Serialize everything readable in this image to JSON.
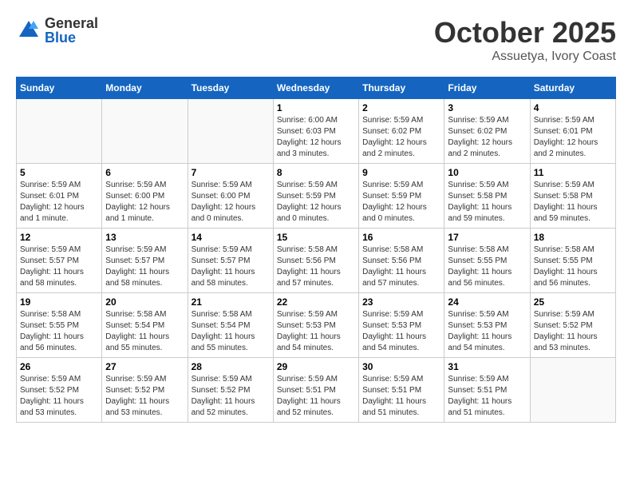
{
  "logo": {
    "general": "General",
    "blue": "Blue"
  },
  "title": {
    "month": "October 2025",
    "location": "Assuetya, Ivory Coast"
  },
  "headers": [
    "Sunday",
    "Monday",
    "Tuesday",
    "Wednesday",
    "Thursday",
    "Friday",
    "Saturday"
  ],
  "weeks": [
    [
      {
        "day": "",
        "info": ""
      },
      {
        "day": "",
        "info": ""
      },
      {
        "day": "",
        "info": ""
      },
      {
        "day": "1",
        "info": "Sunrise: 6:00 AM\nSunset: 6:03 PM\nDaylight: 12 hours\nand 3 minutes."
      },
      {
        "day": "2",
        "info": "Sunrise: 5:59 AM\nSunset: 6:02 PM\nDaylight: 12 hours\nand 2 minutes."
      },
      {
        "day": "3",
        "info": "Sunrise: 5:59 AM\nSunset: 6:02 PM\nDaylight: 12 hours\nand 2 minutes."
      },
      {
        "day": "4",
        "info": "Sunrise: 5:59 AM\nSunset: 6:01 PM\nDaylight: 12 hours\nand 2 minutes."
      }
    ],
    [
      {
        "day": "5",
        "info": "Sunrise: 5:59 AM\nSunset: 6:01 PM\nDaylight: 12 hours\nand 1 minute."
      },
      {
        "day": "6",
        "info": "Sunrise: 5:59 AM\nSunset: 6:00 PM\nDaylight: 12 hours\nand 1 minute."
      },
      {
        "day": "7",
        "info": "Sunrise: 5:59 AM\nSunset: 6:00 PM\nDaylight: 12 hours\nand 0 minutes."
      },
      {
        "day": "8",
        "info": "Sunrise: 5:59 AM\nSunset: 5:59 PM\nDaylight: 12 hours\nand 0 minutes."
      },
      {
        "day": "9",
        "info": "Sunrise: 5:59 AM\nSunset: 5:59 PM\nDaylight: 12 hours\nand 0 minutes."
      },
      {
        "day": "10",
        "info": "Sunrise: 5:59 AM\nSunset: 5:58 PM\nDaylight: 11 hours\nand 59 minutes."
      },
      {
        "day": "11",
        "info": "Sunrise: 5:59 AM\nSunset: 5:58 PM\nDaylight: 11 hours\nand 59 minutes."
      }
    ],
    [
      {
        "day": "12",
        "info": "Sunrise: 5:59 AM\nSunset: 5:57 PM\nDaylight: 11 hours\nand 58 minutes."
      },
      {
        "day": "13",
        "info": "Sunrise: 5:59 AM\nSunset: 5:57 PM\nDaylight: 11 hours\nand 58 minutes."
      },
      {
        "day": "14",
        "info": "Sunrise: 5:59 AM\nSunset: 5:57 PM\nDaylight: 11 hours\nand 58 minutes."
      },
      {
        "day": "15",
        "info": "Sunrise: 5:58 AM\nSunset: 5:56 PM\nDaylight: 11 hours\nand 57 minutes."
      },
      {
        "day": "16",
        "info": "Sunrise: 5:58 AM\nSunset: 5:56 PM\nDaylight: 11 hours\nand 57 minutes."
      },
      {
        "day": "17",
        "info": "Sunrise: 5:58 AM\nSunset: 5:55 PM\nDaylight: 11 hours\nand 56 minutes."
      },
      {
        "day": "18",
        "info": "Sunrise: 5:58 AM\nSunset: 5:55 PM\nDaylight: 11 hours\nand 56 minutes."
      }
    ],
    [
      {
        "day": "19",
        "info": "Sunrise: 5:58 AM\nSunset: 5:55 PM\nDaylight: 11 hours\nand 56 minutes."
      },
      {
        "day": "20",
        "info": "Sunrise: 5:58 AM\nSunset: 5:54 PM\nDaylight: 11 hours\nand 55 minutes."
      },
      {
        "day": "21",
        "info": "Sunrise: 5:58 AM\nSunset: 5:54 PM\nDaylight: 11 hours\nand 55 minutes."
      },
      {
        "day": "22",
        "info": "Sunrise: 5:59 AM\nSunset: 5:53 PM\nDaylight: 11 hours\nand 54 minutes."
      },
      {
        "day": "23",
        "info": "Sunrise: 5:59 AM\nSunset: 5:53 PM\nDaylight: 11 hours\nand 54 minutes."
      },
      {
        "day": "24",
        "info": "Sunrise: 5:59 AM\nSunset: 5:53 PM\nDaylight: 11 hours\nand 54 minutes."
      },
      {
        "day": "25",
        "info": "Sunrise: 5:59 AM\nSunset: 5:52 PM\nDaylight: 11 hours\nand 53 minutes."
      }
    ],
    [
      {
        "day": "26",
        "info": "Sunrise: 5:59 AM\nSunset: 5:52 PM\nDaylight: 11 hours\nand 53 minutes."
      },
      {
        "day": "27",
        "info": "Sunrise: 5:59 AM\nSunset: 5:52 PM\nDaylight: 11 hours\nand 53 minutes."
      },
      {
        "day": "28",
        "info": "Sunrise: 5:59 AM\nSunset: 5:52 PM\nDaylight: 11 hours\nand 52 minutes."
      },
      {
        "day": "29",
        "info": "Sunrise: 5:59 AM\nSunset: 5:51 PM\nDaylight: 11 hours\nand 52 minutes."
      },
      {
        "day": "30",
        "info": "Sunrise: 5:59 AM\nSunset: 5:51 PM\nDaylight: 11 hours\nand 51 minutes."
      },
      {
        "day": "31",
        "info": "Sunrise: 5:59 AM\nSunset: 5:51 PM\nDaylight: 11 hours\nand 51 minutes."
      },
      {
        "day": "",
        "info": ""
      }
    ]
  ]
}
